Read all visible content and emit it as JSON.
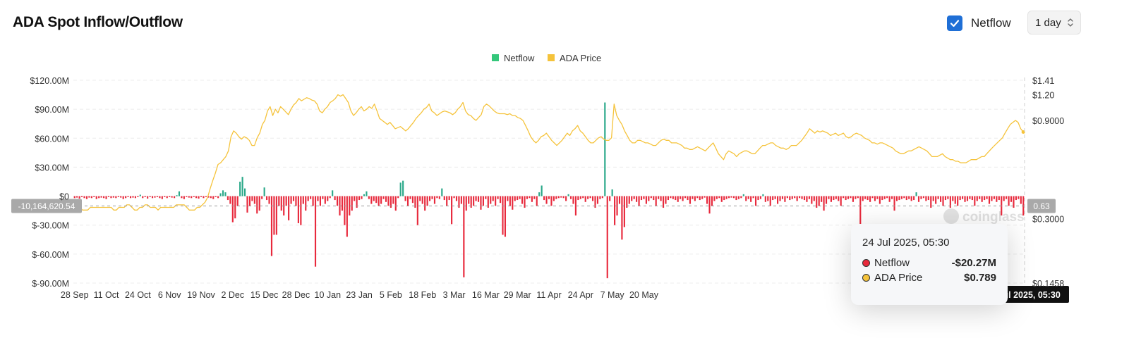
{
  "header": {
    "title": "ADA Spot Inflow/Outflow",
    "netflow_toggle": {
      "label": "Netflow",
      "checked": true
    },
    "interval": "1 day"
  },
  "colors": {
    "inflow": "#2aa889",
    "outflow": "#e8293c",
    "legend_netflow": "#34c77b",
    "price": "#f5c33b",
    "grid": "#ececec",
    "axis_text": "#333333"
  },
  "crosshair": {
    "netflow_label": "-10,164,620.54",
    "price_label": "0.63",
    "date_label": "24 Jul 2025, 05:30"
  },
  "tooltip": {
    "date": "24 Jul 2025, 05:30",
    "rows": [
      {
        "name": "Netflow",
        "value": "-$20.27M",
        "dot_color": "#e8293c"
      },
      {
        "name": "ADA Price",
        "value": "$0.789",
        "dot_color": "#f5c33b"
      }
    ]
  },
  "watermark": "coinglass",
  "chart_data": {
    "type": "bar+line",
    "title": "ADA Spot Inflow/Outflow",
    "legend": {
      "placement": "top-center",
      "entries": [
        "Netflow",
        "ADA Price"
      ]
    },
    "grid": true,
    "x_ticks": [
      "28 Sep",
      "11 Oct",
      "24 Oct",
      "6 Nov",
      "19 Nov",
      "2 Dec",
      "15 Dec",
      "28 Dec",
      "10 Jan",
      "23 Jan",
      "5 Feb",
      "18 Feb",
      "3 Mar",
      "16 Mar",
      "29 Mar",
      "11 Apr",
      "24 Apr",
      "7 May",
      "20 May"
    ],
    "y_left": {
      "ticks": [
        "$120.00M",
        "$90.00M",
        "$60.00M",
        "$30.00M",
        "$0",
        "$-30.00M",
        "$-60.00M",
        "$-90.00M"
      ],
      "values": [
        120,
        90,
        60,
        30,
        0,
        -30,
        -60,
        -90
      ],
      "unit": "USD millions"
    },
    "y_right": {
      "ticks": [
        "$1.41",
        "$1.20",
        "$0.9000",
        "$0.3000",
        "$0.1458"
      ],
      "values": [
        1.41,
        1.2,
        0.9,
        0.3,
        0.1458
      ],
      "scale": "log"
    },
    "series": [
      {
        "name": "Netflow",
        "kind": "bar",
        "start_date": "2024-09-28",
        "values": [
          -2,
          -1.5,
          -2.5,
          -1,
          -2,
          -3,
          -1.5,
          -2,
          -1,
          -3,
          -2,
          -1.5,
          -2,
          -3,
          -1,
          -2,
          -1.5,
          -2,
          -1,
          -1.5,
          -3,
          -2,
          -1,
          -2,
          -1.5,
          -2,
          -1,
          1.5,
          -2,
          -1,
          -2.5,
          -1,
          -2,
          -1.5,
          -1,
          -2,
          -3,
          -1,
          -2,
          -1,
          -1.5,
          -2,
          1,
          5,
          -2,
          -3,
          -1,
          -1.5,
          -2,
          -1,
          -2,
          -2.5,
          -1,
          -2,
          -1,
          -1.5,
          -2,
          -3,
          -1,
          -2,
          3,
          6,
          4,
          -4,
          -8,
          -27,
          -23,
          -10,
          15,
          20,
          8,
          -17,
          -10,
          -5,
          -8,
          -18,
          -15,
          -3,
          9,
          -4,
          -8,
          -62,
          -40,
          -40,
          -10,
          -15,
          -20,
          -10,
          -25,
          -8,
          -5,
          -10,
          -28,
          -30,
          -8,
          -15,
          -5,
          -3,
          -10,
          -73,
          -5,
          -10,
          -3,
          -8,
          -5,
          -2,
          6,
          -4,
          -10,
          -20,
          -15,
          -30,
          -42,
          -20,
          -15,
          -5,
          -12,
          -4,
          -3,
          2,
          5,
          -3,
          -8,
          -5,
          -7,
          -10,
          -8,
          -3,
          -6,
          -10,
          -12,
          -8,
          -15,
          -2,
          14,
          16,
          -5,
          -10,
          -3,
          -7,
          -12,
          -30,
          -5,
          -8,
          -15,
          -10,
          -5,
          -3,
          -8,
          -2,
          -3,
          8,
          -4,
          -10,
          -4,
          -29,
          -2,
          -5,
          -12,
          -8,
          -84,
          -15,
          -8,
          -12,
          -10,
          -5,
          -6,
          -14,
          -10,
          -3,
          -12,
          -8,
          -5,
          -10,
          -3,
          -7,
          -40,
          -42,
          -5,
          -10,
          -14,
          -5,
          -4,
          -3,
          -8,
          -12,
          -3,
          -2,
          -6,
          -3,
          -10,
          4,
          11,
          -4,
          -8,
          -3,
          -10,
          -5,
          -3,
          -2,
          -1.5,
          -2,
          -5,
          2,
          -3,
          -8,
          -20,
          -4,
          -3,
          -2,
          -6,
          -3,
          -2,
          -5,
          -12,
          -8,
          -3,
          -2,
          97,
          -85,
          -5,
          7,
          -30,
          -20,
          -8,
          -45,
          -32,
          -12,
          -8,
          -5,
          -3,
          -6,
          -10,
          -4,
          -3,
          -8,
          -5,
          -2,
          -4,
          -10,
          -3,
          -5,
          -12,
          -8,
          -4,
          -2,
          -3,
          -4,
          -6,
          -3,
          -5,
          -2,
          -4,
          -8,
          -3,
          -5,
          -2,
          -4,
          -3,
          -1.5,
          -8,
          -18,
          -10,
          -5,
          -3,
          -2,
          -6,
          -4,
          -3,
          -2,
          -1.5,
          -2,
          -4,
          -3,
          -2,
          2,
          -5,
          -3,
          -6,
          -2,
          -10,
          -4,
          -3,
          2,
          -6,
          -5,
          -10,
          -4,
          -3,
          -8,
          -5,
          -3,
          -6,
          -2,
          -4,
          -3,
          -2,
          -5,
          -2,
          -3,
          -4,
          -6,
          -3,
          -8,
          -5,
          -12,
          -10,
          -6,
          -15,
          -8,
          -3,
          -6,
          -4,
          -3,
          -5,
          -10,
          -2,
          -4,
          -3,
          -2,
          -6,
          -3,
          -2,
          -35,
          -5,
          -3,
          -4,
          -6,
          -2,
          -5,
          -3,
          -8,
          -4,
          -3,
          -2,
          -6,
          -3,
          -15,
          -5,
          -4,
          -3,
          -2,
          -4,
          -3,
          -5,
          -4,
          4,
          -6,
          -3,
          -2,
          -5,
          -4,
          -12,
          -5,
          -8,
          -3,
          -6,
          -10,
          -4,
          -3,
          -12,
          -5,
          -8,
          -10,
          -4,
          -3,
          -6,
          -5,
          -3,
          -4,
          -10,
          -5,
          -3,
          -6,
          -4,
          -3,
          -8,
          -5,
          -3,
          -6,
          -4,
          -20,
          -5,
          -3,
          -10,
          -6,
          -12,
          -4,
          -3,
          -8,
          -20
        ]
      },
      {
        "name": "ADA Price",
        "kind": "line",
        "start_date": "2024-09-28",
        "values": [
          0.36,
          0.35,
          0.34,
          0.33,
          0.33,
          0.33,
          0.34,
          0.34,
          0.34,
          0.34,
          0.34,
          0.34,
          0.34,
          0.34,
          0.34,
          0.33,
          0.33,
          0.34,
          0.34,
          0.34,
          0.35,
          0.35,
          0.34,
          0.33,
          0.33,
          0.34,
          0.34,
          0.35,
          0.35,
          0.34,
          0.34,
          0.34,
          0.33,
          0.34,
          0.34,
          0.34,
          0.34,
          0.34,
          0.34,
          0.35,
          0.35,
          0.35,
          0.35,
          0.34,
          0.33,
          0.33,
          0.33,
          0.34,
          0.34,
          0.35,
          0.36,
          0.38,
          0.42,
          0.46,
          0.5,
          0.55,
          0.56,
          0.58,
          0.6,
          0.64,
          0.75,
          0.8,
          0.78,
          0.75,
          0.73,
          0.75,
          0.74,
          0.72,
          0.68,
          0.68,
          0.74,
          0.78,
          0.86,
          0.9,
          1.0,
          1.05,
          0.95,
          1.02,
          0.98,
          1.05,
          1.02,
          0.99,
          0.96,
          1.02,
          1.07,
          1.1,
          1.15,
          1.12,
          1.14,
          1.16,
          1.15,
          1.13,
          1.12,
          1.08,
          1.0,
          0.98,
          1.02,
          1.05,
          1.1,
          1.12,
          1.15,
          1.2,
          1.18,
          1.2,
          1.15,
          1.1,
          1.0,
          0.95,
          0.98,
          1.02,
          1.05,
          1.0,
          1.02,
          1.05,
          1.03,
          1.08,
          1.0,
          0.92,
          0.9,
          0.88,
          0.86,
          0.88,
          0.85,
          0.82,
          0.83,
          0.84,
          0.82,
          0.8,
          0.82,
          0.85,
          0.88,
          0.92,
          0.95,
          0.98,
          1.02,
          1.04,
          1.08,
          1.0,
          0.98,
          0.95,
          0.97,
          0.99,
          1.0,
          0.99,
          0.98,
          0.96,
          0.98,
          1.02,
          1.05,
          1.1,
          1.0,
          0.96,
          0.95,
          0.92,
          0.9,
          0.93,
          0.96,
          1.05,
          1.08,
          1.06,
          1.03,
          1.0,
          0.98,
          0.97,
          0.97,
          0.97,
          0.96,
          0.97,
          0.95,
          0.95,
          0.93,
          0.92,
          0.9,
          0.85,
          0.8,
          0.75,
          0.72,
          0.7,
          0.72,
          0.75,
          0.76,
          0.78,
          0.75,
          0.72,
          0.7,
          0.68,
          0.7,
          0.72,
          0.75,
          0.78,
          0.76,
          0.8,
          0.82,
          0.85,
          0.8,
          0.78,
          0.75,
          0.72,
          0.7,
          0.7,
          0.72,
          0.74,
          0.75,
          0.73,
          0.72,
          0.72,
          0.74,
          1.08,
          0.95,
          0.9,
          0.86,
          0.8,
          0.76,
          0.72,
          0.7,
          0.7,
          0.72,
          0.72,
          0.71,
          0.7,
          0.7,
          0.69,
          0.68,
          0.68,
          0.7,
          0.72,
          0.73,
          0.72,
          0.72,
          0.7,
          0.7,
          0.7,
          0.69,
          0.68,
          0.66,
          0.66,
          0.65,
          0.65,
          0.66,
          0.67,
          0.66,
          0.65,
          0.64,
          0.66,
          0.68,
          0.7,
          0.66,
          0.62,
          0.6,
          0.58,
          0.62,
          0.64,
          0.63,
          0.62,
          0.6,
          0.62,
          0.63,
          0.64,
          0.64,
          0.63,
          0.62,
          0.62,
          0.64,
          0.66,
          0.68,
          0.68,
          0.69,
          0.7,
          0.7,
          0.68,
          0.67,
          0.66,
          0.66,
          0.65,
          0.66,
          0.68,
          0.68,
          0.68,
          0.7,
          0.72,
          0.75,
          0.78,
          0.82,
          0.8,
          0.78,
          0.8,
          0.79,
          0.8,
          0.79,
          0.78,
          0.76,
          0.77,
          0.78,
          0.76,
          0.77,
          0.78,
          0.75,
          0.74,
          0.75,
          0.77,
          0.78,
          0.77,
          0.76,
          0.74,
          0.73,
          0.72,
          0.7,
          0.7,
          0.69,
          0.7,
          0.7,
          0.69,
          0.68,
          0.67,
          0.66,
          0.64,
          0.63,
          0.62,
          0.62,
          0.63,
          0.64,
          0.64,
          0.65,
          0.66,
          0.67,
          0.66,
          0.65,
          0.64,
          0.62,
          0.6,
          0.6,
          0.6,
          0.61,
          0.62,
          0.6,
          0.59,
          0.58,
          0.58,
          0.57,
          0.57,
          0.56,
          0.56,
          0.56,
          0.57,
          0.58,
          0.58,
          0.58,
          0.59,
          0.6,
          0.6,
          0.62,
          0.64,
          0.66,
          0.68,
          0.7,
          0.72,
          0.74,
          0.78,
          0.82,
          0.86,
          0.88,
          0.9,
          0.88,
          0.82,
          0.79
        ]
      }
    ]
  }
}
